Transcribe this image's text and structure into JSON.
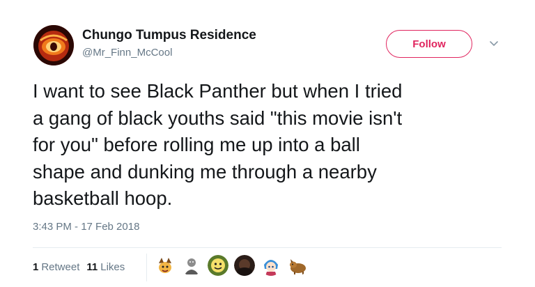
{
  "author": {
    "display_name": "Chungo Tumpus Residence",
    "handle": "@Mr_Finn_McCool",
    "avatar_icon": "fiery-eye-avatar-icon"
  },
  "actions": {
    "follow_label": "Follow",
    "more_icon": "chevron-down-icon"
  },
  "tweet": {
    "lines": [
      "I want to see Black Panther but when I tried",
      "a gang of black youths said \"this movie isn't",
      "for you\" before rolling me up into a ball",
      "shape and dunking me through a nearby",
      "basketball hoop."
    ],
    "timestamp": "3:43 PM - 17 Feb 2018"
  },
  "stats": {
    "retweets_count": "1",
    "retweets_label": "Retweet",
    "likes_count": "11",
    "likes_label": "Likes"
  },
  "likers": [
    {
      "icon": "cartoon-character-avatar-icon"
    },
    {
      "icon": "grey-figure-avatar-icon"
    },
    {
      "icon": "green-smiley-avatar-icon"
    },
    {
      "icon": "dark-photo-avatar-icon"
    },
    {
      "icon": "blue-hair-anime-avatar-icon"
    },
    {
      "icon": "brown-dog-avatar-icon"
    }
  ],
  "colors": {
    "accent": "#e0245e",
    "text": "#14171a",
    "secondary_text": "#657786",
    "divider": "#e6ecf0"
  }
}
